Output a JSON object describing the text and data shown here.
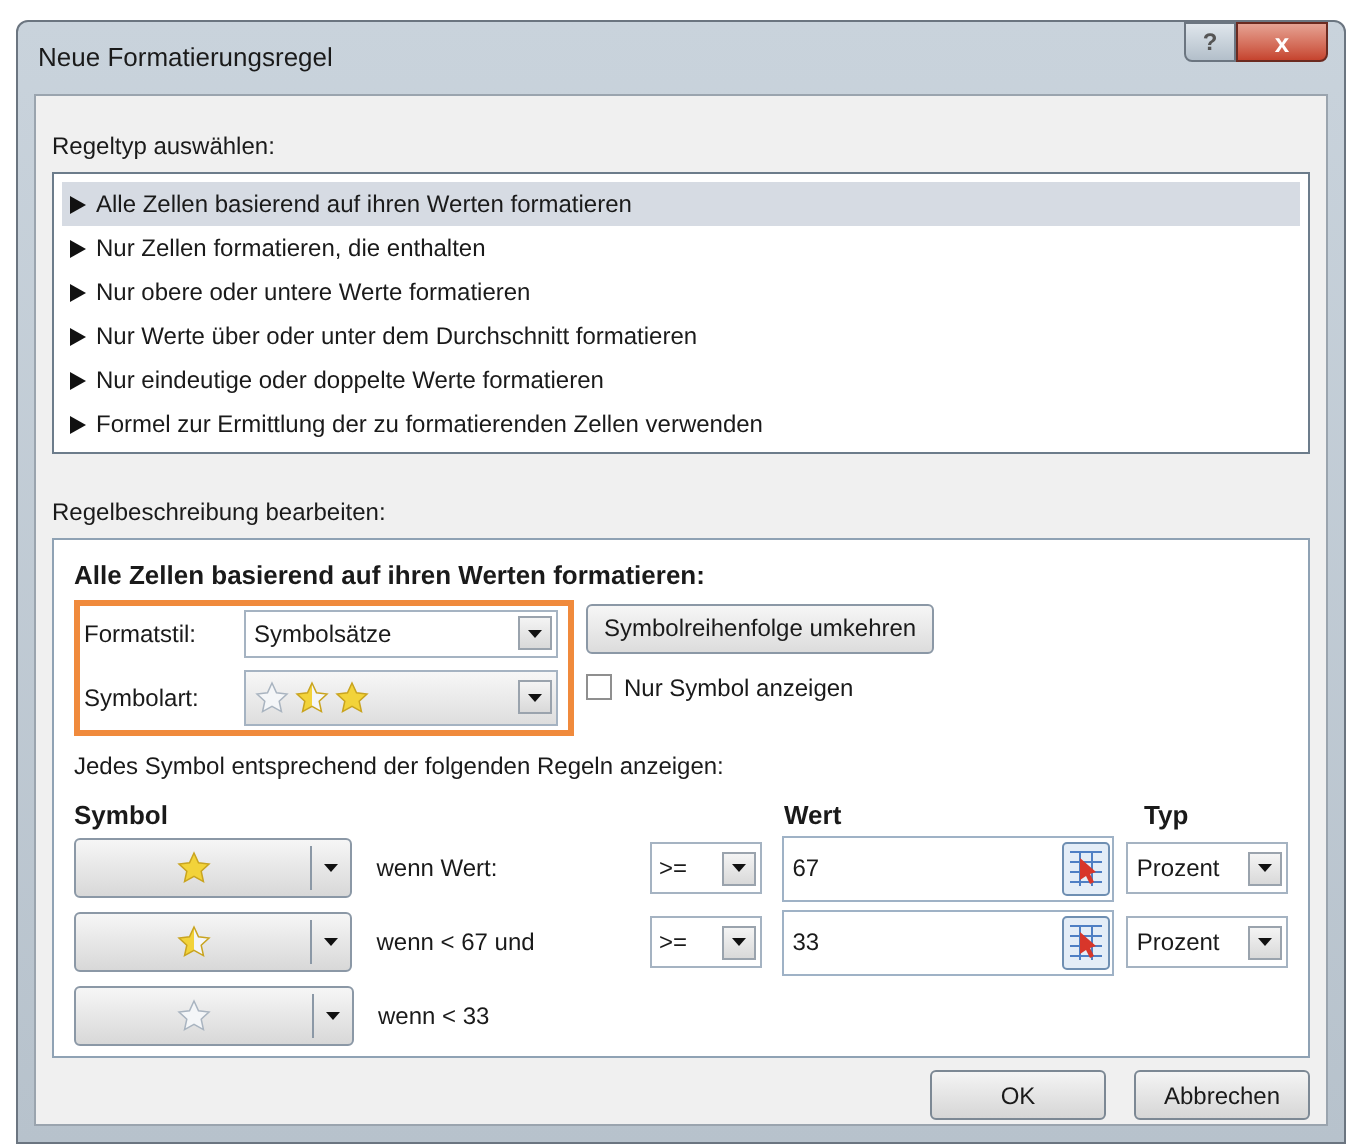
{
  "window": {
    "title": "Neue Formatierungsregel",
    "buttons": [
      "?",
      "x"
    ]
  },
  "rule_type": {
    "label": "Regeltyp auswählen:",
    "items": [
      {
        "label": "Alle Zellen basierend auf ihren Werten formatieren",
        "selected": true
      },
      {
        "label": "Nur Zellen formatieren, die enthalten",
        "selected": false
      },
      {
        "label": "Nur obere oder untere Werte formatieren",
        "selected": false
      },
      {
        "label": "Nur Werte über oder unter dem Durchschnitt formatieren",
        "selected": false
      },
      {
        "label": "Nur eindeutige oder doppelte Werte formatieren",
        "selected": false
      },
      {
        "label": "Formel zur Ermittlung der zu formatierenden Zellen verwenden",
        "selected": false
      }
    ]
  },
  "description": {
    "label": "Regelbeschreibung bearbeiten:",
    "heading": "Alle Zellen basierend auf ihren Werten formatieren:",
    "format_style": {
      "label": "Formatstil:",
      "value": "Symbolsätze"
    },
    "reverse_button": "Symbolreihenfolge umkehren",
    "symbol_type": {
      "label": "Symbolart:",
      "symbols": [
        {
          "kind": "empty"
        },
        {
          "kind": "half"
        },
        {
          "kind": "full"
        }
      ]
    },
    "symbol_only": {
      "label": "Nur Symbol anzeigen",
      "checked": false
    },
    "instruction": "Jedes Symbol entsprechend der folgenden Regeln anzeigen:",
    "columns": {
      "symbol": "Symbol",
      "value": "Wert",
      "type": "Typ"
    },
    "rules": [
      {
        "symbol": {
          "kind": "full"
        },
        "condition": "wenn Wert:",
        "operator": ">=",
        "value": "67",
        "type": "Prozent"
      },
      {
        "symbol": {
          "kind": "half"
        },
        "condition": "wenn < 67 und",
        "operator": ">=",
        "value": "33",
        "type": "Prozent"
      },
      {
        "symbol": {
          "kind": "empty"
        },
        "condition": "wenn < 33"
      }
    ]
  },
  "buttons": [
    "OK",
    "Abbrechen"
  ]
}
